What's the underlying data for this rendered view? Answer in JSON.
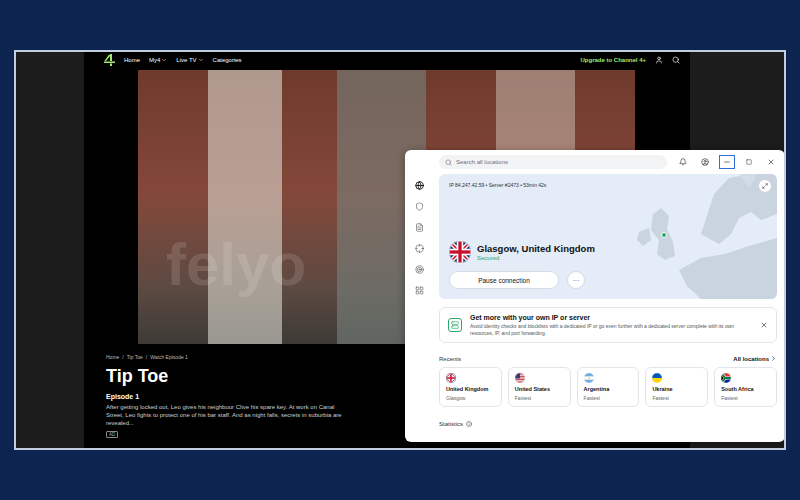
{
  "browser": {
    "nav": {
      "links": [
        {
          "label": "Home",
          "dropdown": false
        },
        {
          "label": "My4",
          "dropdown": true
        },
        {
          "label": "Live TV",
          "dropdown": true
        },
        {
          "label": "Categories",
          "dropdown": false
        }
      ],
      "upgrade": "Upgrade to Channel 4+"
    },
    "breadcrumb": {
      "items": [
        "Home",
        "Tip Toe",
        "Watch Episode 1"
      ],
      "separator": "/"
    },
    "title": "Tip Toe",
    "episode": "Episode 1",
    "description": "After getting locked out, Leo gives his neighbour Clive his spare key. At work on Canal Street, Leo fights to protect one of his bar staff. And as night falls, secrets in suburbia are revealed...",
    "badge": "AD"
  },
  "watermark": "felyo",
  "vpn": {
    "search": {
      "placeholder": "Search all locations"
    },
    "window_controls": [
      {
        "kind": "minimize",
        "highlighted": true
      },
      {
        "kind": "maximize",
        "highlighted": false
      },
      {
        "kind": "close",
        "highlighted": false
      }
    ],
    "rail": [
      {
        "kind": "globe",
        "selected": true
      },
      {
        "kind": "shield",
        "selected": false
      },
      {
        "kind": "file",
        "selected": false
      },
      {
        "kind": "crosshair",
        "selected": false
      },
      {
        "kind": "target",
        "selected": false
      },
      {
        "kind": "grid",
        "selected": false
      }
    ],
    "status_line": "IP 84.247.42.59 • Server #2473 • 53min 42s",
    "location": {
      "name": "Glasgow, United Kingdom",
      "status": "Secured",
      "kind": "uk"
    },
    "pause_button": "Pause connection",
    "more_button": "···",
    "promo": {
      "title": "Get more with your own IP or server",
      "description": "Avoid identity checks and blocklists with a dedicated IP or go even further with a dedicated server complete with its own resources, IP, and port forwarding."
    },
    "recents": {
      "title": "Recents",
      "all_link": "All locations",
      "items": [
        {
          "country": "United Kingdom",
          "detail": "Glasgow",
          "kind": "uk"
        },
        {
          "country": "United States",
          "detail": "Fastest",
          "kind": "us"
        },
        {
          "country": "Argentina",
          "detail": "Fastest",
          "kind": "ar"
        },
        {
          "country": "Ukraine",
          "detail": "Fastest",
          "kind": "ua"
        },
        {
          "country": "South Africa",
          "detail": "Fastest",
          "kind": "za"
        }
      ]
    },
    "statistics": "Statistics"
  }
}
